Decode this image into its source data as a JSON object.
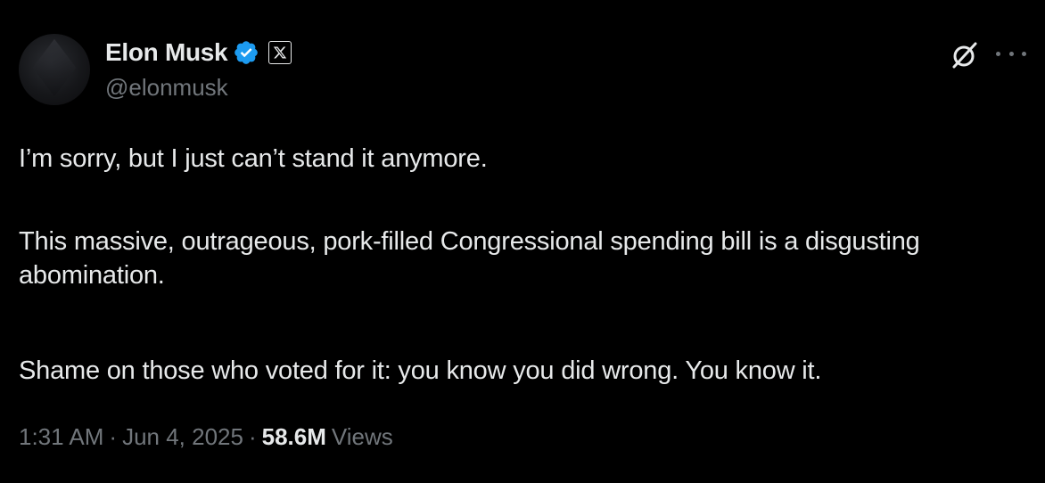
{
  "author": {
    "display_name": "Elon Musk",
    "handle": "@elonmusk"
  },
  "colors": {
    "background": "#000000",
    "primary_text": "#e7e9ea",
    "secondary_text": "#71767b",
    "verified_blue": "#1d9bf0"
  },
  "icons": {
    "verified": "verified-badge-icon",
    "affiliation": "x-logo-icon",
    "grok": "grok-icon",
    "more": "more-options-icon"
  },
  "tweet": {
    "paragraphs": [
      "I’m sorry, but I just can’t stand it anymore.",
      "This massive, outrageous, pork-filled Congressional spending bill is a disgusting abomination.",
      "Shame on those who voted for it: you know you did wrong. You know it."
    ],
    "time": "1:31 AM",
    "date": "Jun 4, 2025",
    "separator": "·",
    "views_count": "58.6M",
    "views_label": "Views"
  }
}
